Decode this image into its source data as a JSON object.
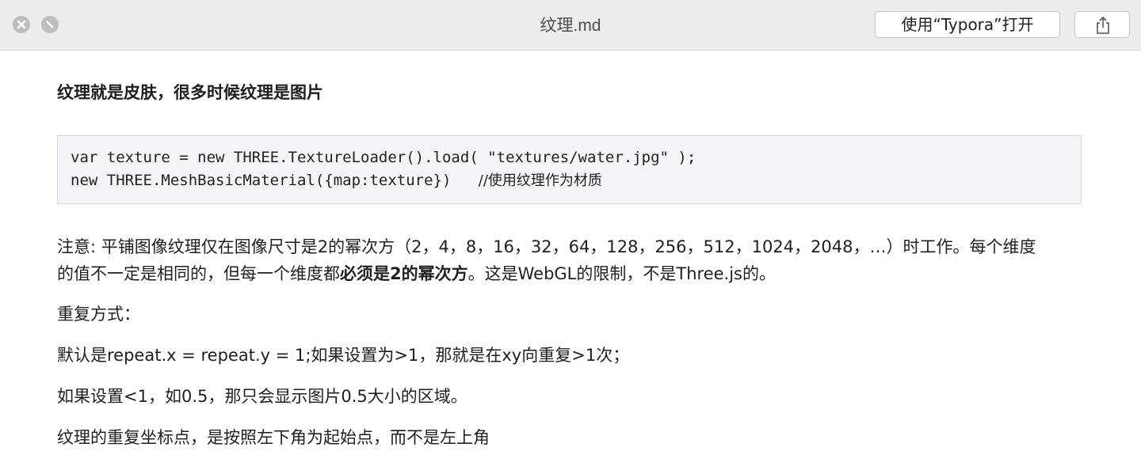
{
  "window": {
    "title": "纹理.md",
    "open_button_label": "使用“Typora”打开"
  },
  "document": {
    "heading": "纹理就是皮肤，很多时候纹理是图片",
    "code": {
      "line1": "var texture = new THREE.TextureLoader().load( \"textures/water.jpg\" );",
      "line2_code": "new THREE.MeshBasicMaterial({map:texture})   ",
      "line2_comment": "//使用纹理作为材质"
    },
    "note": {
      "line1": "注意: 平铺图像纹理仅在图像尺寸是2的幂次方（2，4，8，16，32，64，128，256，512，1024，2048，…）时工作。每个维度",
      "line2_pre": "的值不一定是相同的，但每一个维度都",
      "line2_bold": "必须是2的幂次方",
      "line2_post": "。这是WebGL的限制，不是Three.js的。"
    },
    "repeat_heading": "重复方式：",
    "repeat_default": "默认是repeat.x = repeat.y = 1;如果设置为>1，那就是在xy向重复>1次；",
    "repeat_less": "如果设置<1，如0.5，那只会显示图片0.5大小的区域。",
    "repeat_origin": "纹理的重复坐标点，是按照左下角为起始点，而不是左上角"
  },
  "icons": [
    "close-icon",
    "minimize-icon",
    "share-icon"
  ]
}
